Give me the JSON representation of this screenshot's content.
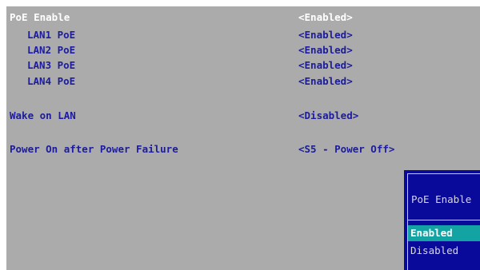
{
  "settings": [
    {
      "label": "PoE Enable",
      "value": "<Enabled>"
    },
    {
      "label": "LAN1 PoE",
      "value": "<Enabled>"
    },
    {
      "label": "LAN2 PoE",
      "value": "<Enabled>"
    },
    {
      "label": "LAN3 PoE",
      "value": "<Enabled>"
    },
    {
      "label": "LAN4 PoE",
      "value": "<Enabled>"
    },
    {
      "label": "Wake on LAN",
      "value": "<Disabled>"
    },
    {
      "label": "Power On after Power Failure",
      "value": "<S5 - Power Off>"
    }
  ],
  "popup": {
    "title": "PoE Enable",
    "options": [
      "Enabled",
      "Disabled"
    ],
    "selected": "Enabled"
  },
  "colors": {
    "background": "#ababab",
    "selected_text": "#ffffff",
    "item_text": "#1c1c9c",
    "popup_background": "#0a0a9a",
    "popup_highlight": "#14a3a3"
  }
}
